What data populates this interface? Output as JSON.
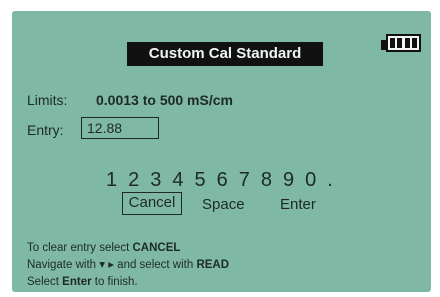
{
  "screen": {
    "title": "Custom Cal Standard",
    "battery_icon": "battery-full-icon",
    "limits_label": "Limits:",
    "limits_value": "0.0013 to 500 mS/cm",
    "entry_label": "Entry:",
    "entry_value": "12.88",
    "keypad": [
      "1",
      "2",
      "3",
      "4",
      "5",
      "6",
      "7",
      "8",
      "9",
      "0",
      "."
    ],
    "cancel_label": "Cancel",
    "space_label": "Space",
    "enter_label": "Enter",
    "help": {
      "line1_prefix": "To clear entry select ",
      "line1_key": "CANCEL",
      "line2_prefix": "Navigate with ",
      "line2_arrows": "▾ ▸",
      "line2_middle": " and select with ",
      "line2_key": "READ",
      "line3_prefix": "Select ",
      "line3_key": "Enter",
      "line3_suffix": " to finish."
    },
    "colors": {
      "background": "#7fb8a5",
      "title_bg": "#111111"
    }
  }
}
